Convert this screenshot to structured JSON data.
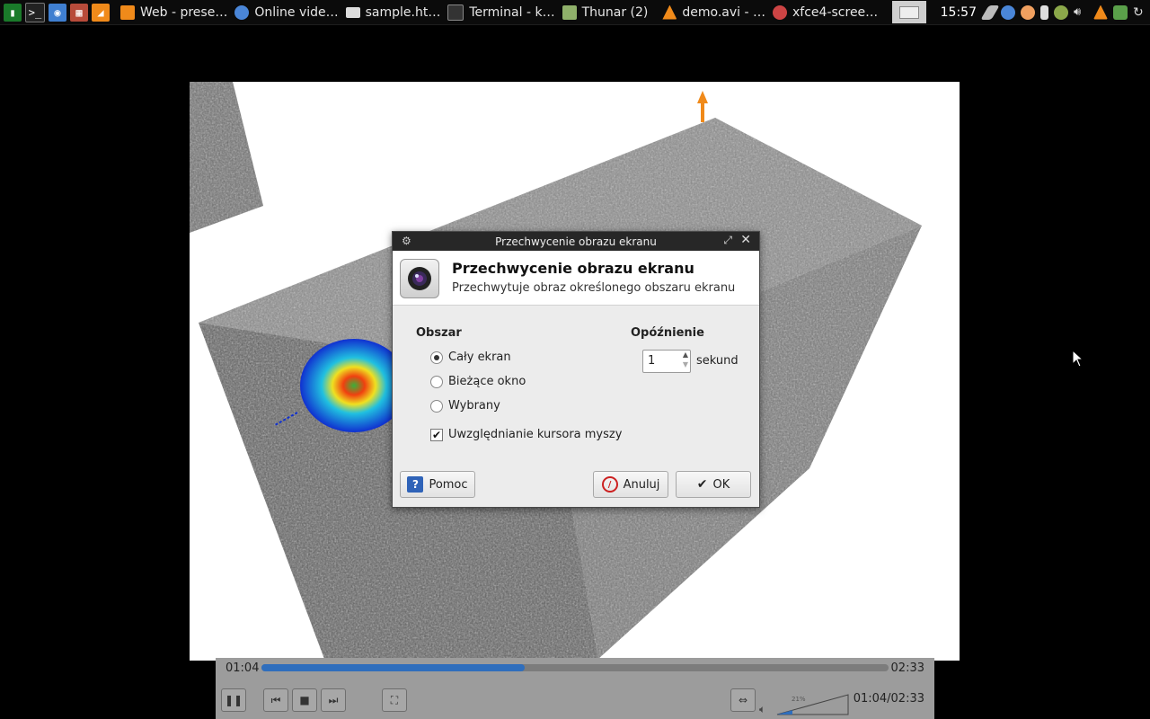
{
  "taskbar": {
    "tasks": [
      {
        "label": "Web - prese…",
        "icon": "web-icon",
        "color": "#f08a1a"
      },
      {
        "label": "Online vide…",
        "icon": "chromium-icon",
        "color": "#4a86d8"
      },
      {
        "label": "sample.ht…",
        "icon": "document-icon",
        "color": "#dcdcdc"
      },
      {
        "label": "Terminal - k…",
        "icon": "terminal-icon",
        "color": "#333333"
      },
      {
        "label": "Thunar (2)",
        "icon": "folder-icon",
        "color": "#8fb06a"
      },
      {
        "label": "demo.avi - …",
        "icon": "vlc-icon",
        "color": "#f08a1a"
      },
      {
        "label": "xfce4-scree…",
        "icon": "screenshooter-icon",
        "color": "#c44"
      }
    ],
    "clock": "15:57"
  },
  "player": {
    "time_elapsed": "01:04",
    "time_total": "02:33",
    "progress": 0.42,
    "volume_percent": "21%",
    "time_display": "01:04/02:33"
  },
  "dialog": {
    "window_title": "Przechwycenie obrazu ekranu",
    "header_title": "Przechwycenie obrazu ekranu",
    "header_subtitle": "Przechwytuje obraz określonego obszaru ekranu",
    "area_section": "Obszar",
    "area_options": [
      {
        "label": "Cały ekran",
        "checked": true
      },
      {
        "label": "Bieżące okno",
        "checked": false
      },
      {
        "label": "Wybrany",
        "checked": false
      }
    ],
    "include_cursor_label": "Uwzględnianie kursora myszy",
    "include_cursor": true,
    "delay_section": "Opóźnienie",
    "delay_value": "1",
    "delay_unit": "sekund",
    "help_label": "Pomoc",
    "cancel_label": "Anuluj",
    "ok_label": "OK"
  }
}
